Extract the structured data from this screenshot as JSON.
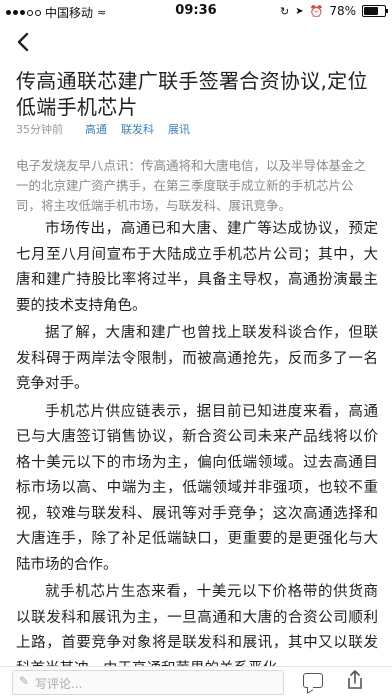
{
  "status": {
    "carrier": "中国移动",
    "time": "09:36",
    "battery": "78%",
    "battery_level": 0.78
  },
  "nav": {
    "back_icon": "chevron-left-icon"
  },
  "article": {
    "title": "传高通联芯建广联手签署合资协议,定位低端手机芯片",
    "time_ago": "35分钟前",
    "tags": [
      "高通",
      "联发科",
      "展讯"
    ],
    "abstract": "电子发烧友早八点讯：传高通将和大唐电信，以及半导体基金之一的北京建广资产携手，在第三季度联手成立新的手机芯片公司，将主攻低端手机市场，与联发科、展讯竞争。",
    "paragraphs": [
      "市场传出，高通已和大唐、建广等达成协议，预定七月至八月间宣布于大陆成立手机芯片公司；其中，大唐和建广持股比率将过半，具备主导权，高通扮演最主要的技术支持角色。",
      "据了解，大唐和建广也曾找上联发科谈合作，但联发科碍于两岸法令限制，而被高通抢先，反而多了一名竞争对手。",
      "手机芯片供应链表示，据目前已知进度来看，高通已与大唐签订销售协议，新合资公司未来产品线将以价格十美元以下的市场为主，偏向低端领域。过去高通目标市场以高、中端为主，低端领域并非强项，也较不重视，较难与联发科、展讯等对手竞争；这次高通选择和大唐连手，除了补足低端缺口，更重要的是更强化与大陆市场的合作。",
      "就手机芯片生态来看，十美元以下价格带的供货商以联发科和展讯为主，一旦高通和大唐的合资公司顺利上路，首要竞争对象将是联发科和展讯，其中又以联发科首当其冲。由于高通和苹果的关系恶化，"
    ]
  },
  "comment_bar": {
    "placeholder": "写评论...",
    "pen_icon": "pen-icon",
    "comment_icon": "comment-icon",
    "share_icon": "share-icon"
  }
}
